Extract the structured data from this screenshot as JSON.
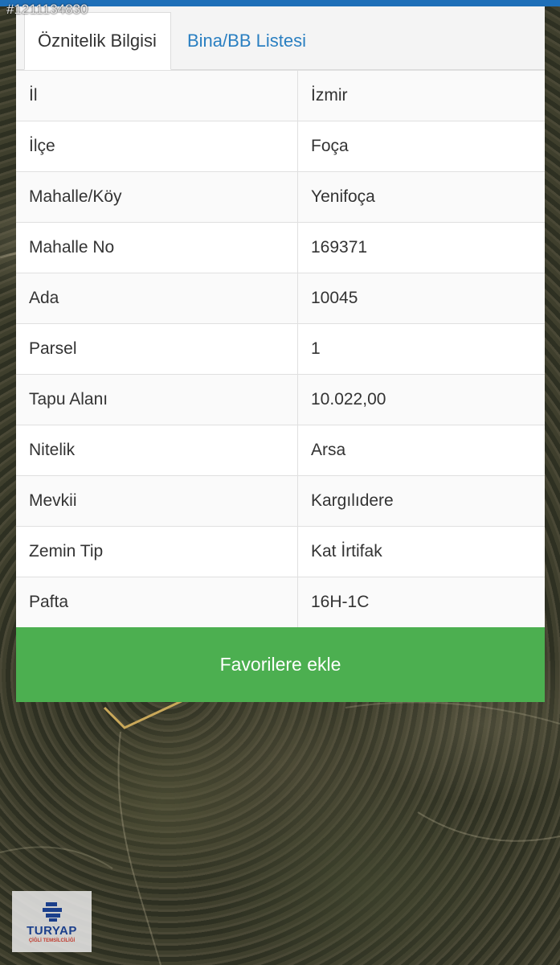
{
  "overlay": {
    "listing_id": "#1211134830"
  },
  "tabs": [
    {
      "label": "Öznitelik Bilgisi",
      "active": true
    },
    {
      "label": "Bina/BB Listesi",
      "active": false
    }
  ],
  "attributes": [
    {
      "key": "İl",
      "value": "İzmir"
    },
    {
      "key": "İlçe",
      "value": "Foça"
    },
    {
      "key": "Mahalle/Köy",
      "value": "Yenifoça"
    },
    {
      "key": "Mahalle No",
      "value": "169371"
    },
    {
      "key": "Ada",
      "value": "10045"
    },
    {
      "key": "Parsel",
      "value": "1"
    },
    {
      "key": "Tapu Alanı",
      "value": "10.022,00"
    },
    {
      "key": "Nitelik",
      "value": "Arsa"
    },
    {
      "key": "Mevkii",
      "value": "Kargılıdere"
    },
    {
      "key": "Zemin Tip",
      "value": "Kat İrtifak"
    },
    {
      "key": "Pafta",
      "value": "16H-1C"
    }
  ],
  "actions": {
    "favorite_label": "Favorilere ekle"
  },
  "logo": {
    "name": "TURYAP",
    "subtitle": "ÇİĞLİ TEMSİLCİLİĞİ"
  },
  "colors": {
    "accent_blue": "#2a7fc1",
    "button_green": "#4caf50",
    "top_bar": "#1e6fb8"
  }
}
